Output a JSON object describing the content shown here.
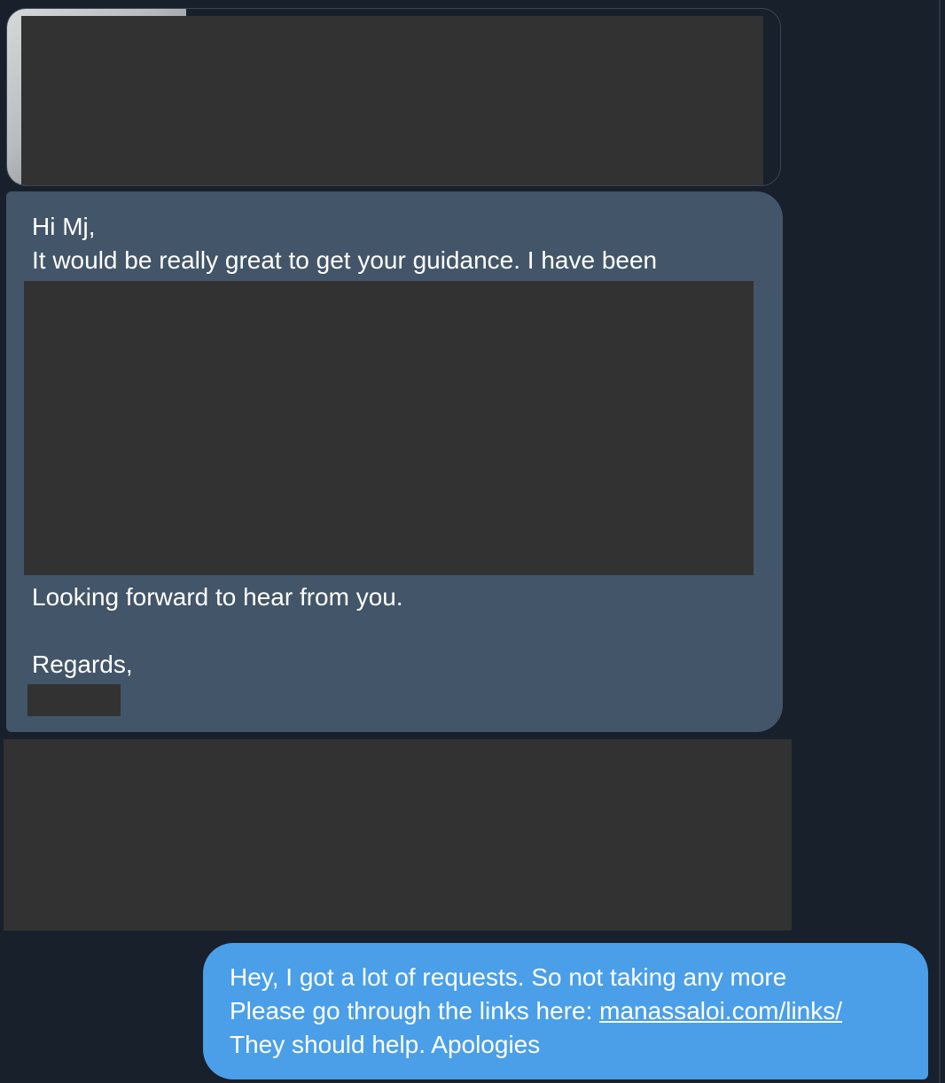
{
  "conversation": {
    "link_preview": {
      "thumbnail": "profile-photo"
    },
    "incoming_message": {
      "greeting": "Hi Mj,",
      "line1": "It would be really great to get your guidance. I have been",
      "closing": "Looking forward to hear from you.",
      "sign_off": "Regards,"
    },
    "outgoing_message": {
      "line1": "Hey, I got a lot of requests. So not taking any more",
      "line2_prefix": "Please go through the links here: ",
      "link_text": "manassaloi.com/links/",
      "line3": "They should help. Apologies"
    }
  },
  "colors": {
    "background": "#18202b",
    "incoming_bubble": "#435568",
    "outgoing_bubble": "#4a9fe8",
    "redaction": "#323232"
  }
}
